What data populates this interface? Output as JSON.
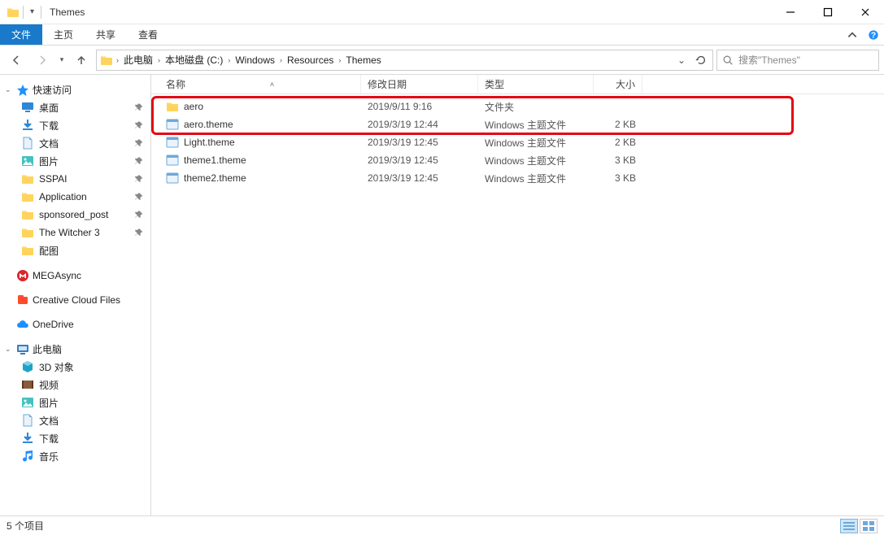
{
  "window": {
    "title": "Themes"
  },
  "ribbon": {
    "file": "文件",
    "tabs": [
      "主页",
      "共享",
      "查看"
    ]
  },
  "breadcrumb": [
    "此电脑",
    "本地磁盘 (C:)",
    "Windows",
    "Resources",
    "Themes"
  ],
  "search": {
    "placeholder": "搜索\"Themes\""
  },
  "sidebar": {
    "quick": {
      "label": "快速访问",
      "items": [
        {
          "label": "桌面",
          "pin": true,
          "icon": "desktop"
        },
        {
          "label": "下载",
          "pin": true,
          "icon": "download"
        },
        {
          "label": "文档",
          "pin": true,
          "icon": "doc"
        },
        {
          "label": "图片",
          "pin": true,
          "icon": "pic"
        },
        {
          "label": "SSPAI",
          "pin": true,
          "icon": "folder"
        },
        {
          "label": "Application",
          "pin": true,
          "icon": "folder"
        },
        {
          "label": "sponsored_post",
          "pin": true,
          "icon": "folder"
        },
        {
          "label": "The Witcher 3",
          "pin": true,
          "icon": "folder"
        },
        {
          "label": "配图",
          "pin": false,
          "icon": "folder"
        }
      ]
    },
    "mega": "MEGAsync",
    "cc": "Creative Cloud Files",
    "onedrive": "OneDrive",
    "pc": {
      "label": "此电脑",
      "items": [
        {
          "label": "3D 对象",
          "icon": "3d"
        },
        {
          "label": "视频",
          "icon": "video"
        },
        {
          "label": "图片",
          "icon": "pic"
        },
        {
          "label": "文档",
          "icon": "doc"
        },
        {
          "label": "下载",
          "icon": "download"
        },
        {
          "label": "音乐",
          "icon": "music"
        }
      ]
    }
  },
  "columns": {
    "name": "名称",
    "date": "修改日期",
    "type": "类型",
    "size": "大小"
  },
  "files": [
    {
      "name": "aero",
      "date": "2019/9/11 9:16",
      "type": "文件夹",
      "size": "",
      "kind": "folder"
    },
    {
      "name": "aero.theme",
      "date": "2019/3/19 12:44",
      "type": "Windows 主题文件",
      "size": "2 KB",
      "kind": "theme"
    },
    {
      "name": "Light.theme",
      "date": "2019/3/19 12:45",
      "type": "Windows 主题文件",
      "size": "2 KB",
      "kind": "theme"
    },
    {
      "name": "theme1.theme",
      "date": "2019/3/19 12:45",
      "type": "Windows 主题文件",
      "size": "3 KB",
      "kind": "theme"
    },
    {
      "name": "theme2.theme",
      "date": "2019/3/19 12:45",
      "type": "Windows 主题文件",
      "size": "3 KB",
      "kind": "theme"
    }
  ],
  "status": {
    "count": "5 个项目"
  }
}
